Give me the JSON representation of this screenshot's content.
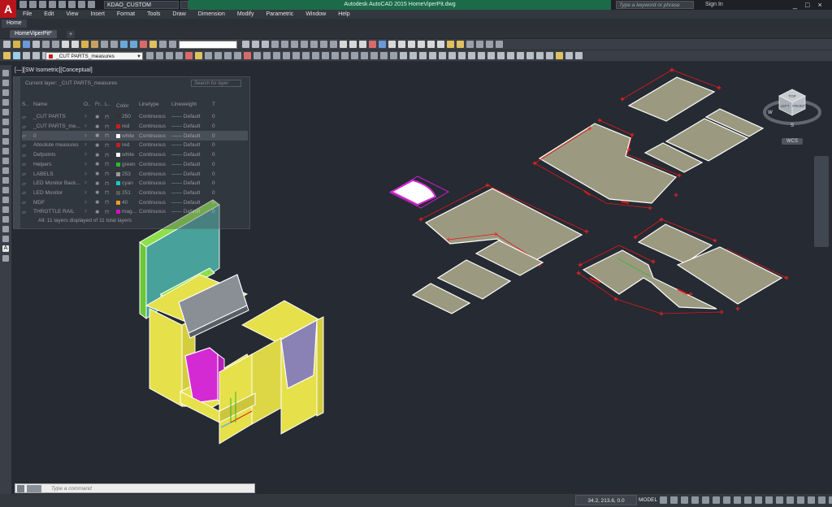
{
  "title_bar": {
    "app_letter": "A",
    "workspace": "KDAO_CUSTOM",
    "title": "Autodesk AutoCAD 2015   HomeViperPit.dwg",
    "search_placeholder": "Type a keyword or phrase",
    "sign_in": "Sign In",
    "controls": [
      "_",
      "□",
      "×"
    ]
  },
  "menu": [
    "File",
    "Edit",
    "View",
    "Insert",
    "Format",
    "Tools",
    "Draw",
    "Dimension",
    "Modify",
    "Parametric",
    "Window",
    "Help"
  ],
  "ribbon": {
    "active_tab": "Home"
  },
  "document_tab": {
    "label": "HomeViperPit*",
    "add": "+"
  },
  "layer_dropdown": "_CUT PARTS_measures",
  "viewport_label": "[—][SW Isometric][Conceptual]",
  "layer_panel": {
    "current_layer": "Current layer: _CUT PARTS_measures",
    "search_placeholder": "Search for layer",
    "headers": [
      "S..",
      "Name",
      "O..",
      "Fr..",
      "L..",
      "Color",
      "Linetype",
      "Lineweight",
      "T"
    ],
    "rows": [
      {
        "name": "_CUT PARTS",
        "color_name": "250",
        "color_hex": "#333333",
        "linetype": "Continuous",
        "lineweight": "—— Default",
        "t": "0",
        "selected": false
      },
      {
        "name": "_CUT PARTS_me...",
        "color_name": "red",
        "color_hex": "#c81e1e",
        "linetype": "Continuous",
        "lineweight": "—— Default",
        "t": "0",
        "selected": false
      },
      {
        "name": "0",
        "color_name": "white",
        "color_hex": "#ffffff",
        "linetype": "Continuous",
        "lineweight": "—— Default",
        "t": "0",
        "selected": true
      },
      {
        "name": "Absolute measures",
        "color_name": "red",
        "color_hex": "#c81e1e",
        "linetype": "Continuous",
        "lineweight": "—— Default",
        "t": "0",
        "selected": false
      },
      {
        "name": "Defpoints",
        "color_name": "white",
        "color_hex": "#ffffff",
        "linetype": "Continuous",
        "lineweight": "—— Default",
        "t": "0",
        "selected": false
      },
      {
        "name": "Helpers",
        "color_name": "green",
        "color_hex": "#2eb82e",
        "linetype": "Continuous",
        "lineweight": "—— Default",
        "t": "0",
        "selected": false
      },
      {
        "name": "LABELS",
        "color_name": "253",
        "color_hex": "#9a9a9a",
        "linetype": "Continuous",
        "lineweight": "—— Default",
        "t": "0",
        "selected": false
      },
      {
        "name": "LED Monitor Back...",
        "color_name": "cyan",
        "color_hex": "#19c8c8",
        "linetype": "Continuous",
        "lineweight": "—— Default",
        "t": "0",
        "selected": false
      },
      {
        "name": "LED Monitor",
        "color_name": "251",
        "color_hex": "#5a5a5a",
        "linetype": "Continuous",
        "lineweight": "—— Default",
        "t": "0",
        "selected": false
      },
      {
        "name": "MDF",
        "color_name": "40",
        "color_hex": "#e8a020",
        "linetype": "Continuous",
        "lineweight": "—— Default",
        "t": "0",
        "selected": false
      },
      {
        "name": "THROTTLE RAIL",
        "color_name": "mag...",
        "color_hex": "#d010c8",
        "linetype": "Continuous",
        "lineweight": "—— Default",
        "t": "0",
        "selected": false
      }
    ],
    "footer": "All: 11 layers displayed of 11 total layers"
  },
  "viewcube": {
    "top": "TOP",
    "left": "LEFT",
    "front": "FRONT",
    "w": "W",
    "s": "S",
    "wcs": "WCS"
  },
  "command_line": {
    "placeholder": "Type a command"
  },
  "status_bar": {
    "coords": "34.2, 213.6, 0.0",
    "model": "MODEL"
  },
  "colors": {
    "panel_fill": "#9b9a80",
    "cabinet_yellow": "#e6e04a",
    "dimension_red": "#e01818",
    "accent_magenta": "#d32ad3",
    "monitor_teal": "#4aa8a0"
  }
}
